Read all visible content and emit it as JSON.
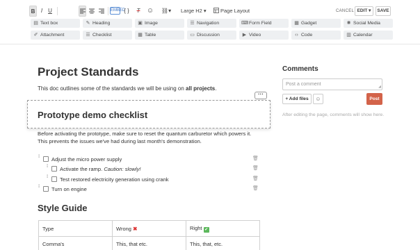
{
  "toolbar": {
    "format": {
      "bold": "B",
      "italic": "I",
      "underline": "U",
      "embed": "EMBED",
      "code": "{ }",
      "clear_format": "T",
      "emoji": "☺",
      "link": "⛓",
      "dropdown_caret": "▾"
    },
    "heading_select": "Large H2 ▾",
    "page_layout": "Page Layout",
    "cancel": "CANCEL",
    "edit": "EDIT ▾",
    "save": "SAVE",
    "insert_items": [
      {
        "label": "Text box",
        "icon": "text-box-icon"
      },
      {
        "label": "Heading",
        "icon": "heading-icon"
      },
      {
        "label": "Image",
        "icon": "image-icon"
      },
      {
        "label": "Navigation",
        "icon": "navigation-icon"
      },
      {
        "label": "Form Field",
        "icon": "form-field-icon"
      },
      {
        "label": "Gadget",
        "icon": "gadget-icon"
      },
      {
        "label": "Social Media",
        "icon": "social-media-icon"
      },
      {
        "label": "Attachment",
        "icon": "attachment-icon"
      },
      {
        "label": "Checklist",
        "icon": "checklist-icon"
      },
      {
        "label": "Table",
        "icon": "table-icon"
      },
      {
        "label": "Discussion",
        "icon": "discussion-icon"
      },
      {
        "label": "Video",
        "icon": "video-icon"
      },
      {
        "label": "Code",
        "icon": "code-icon"
      },
      {
        "label": "Calendar",
        "icon": "calendar-icon"
      }
    ]
  },
  "document": {
    "title": "Project Standards",
    "intro_prefix": "This doc outlines some of the standards we will be using on ",
    "intro_bold": "all projects",
    "intro_suffix": ".",
    "more_menu": "···",
    "dragged_heading": "Prototype demo checklist",
    "para_line1": "Before activating the prototype, make sure to reset the quantum carburetor which powers it.",
    "para_line2": "This prevents the issues we've had during last month's demonstration.",
    "checklist": [
      {
        "text": "Adjust the micro power supply",
        "indent": 0,
        "checked": false
      },
      {
        "text": "Activate the ramp. ",
        "italic": "Caution: slowly!",
        "indent": 1,
        "checked": false
      },
      {
        "text": "Test restored electricity generation using crank",
        "indent": 1,
        "checked": false
      },
      {
        "text": "Turn on engine",
        "indent": 0,
        "checked": false
      }
    ],
    "style_guide_title": "Style Guide",
    "table": {
      "headers": [
        "Type",
        "Wrong",
        "Right"
      ],
      "wrong_mark": "✖",
      "right_mark": "✔",
      "rows": [
        [
          "Comma's",
          "This, that etc.",
          "This, that, etc."
        ]
      ]
    }
  },
  "comments": {
    "title": "Comments",
    "placeholder": "Post a comment",
    "add_files": "+ Add files",
    "emoji": "☺",
    "post": "Post",
    "note": "After editing the page, comments will show here."
  }
}
